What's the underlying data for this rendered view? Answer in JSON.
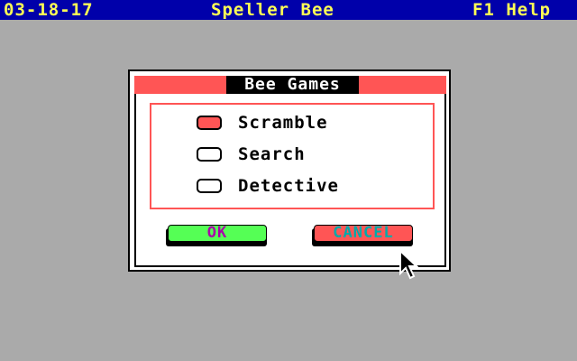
{
  "topbar": {
    "date": "03-18-17",
    "app_title": "Speller Bee",
    "help": "F1 Help"
  },
  "dialog": {
    "title": "Bee Games",
    "options": [
      {
        "label": "Scramble",
        "selected": true
      },
      {
        "label": "Search",
        "selected": false
      },
      {
        "label": "Detective",
        "selected": false
      }
    ],
    "ok_label": "OK",
    "cancel_label": "CANCEL"
  },
  "colors": {
    "background": "#aaaaaa",
    "topbar_bg": "#0000aa",
    "topbar_text": "#ffff55",
    "accent_red": "#ff5555",
    "ok_green": "#55ff55",
    "ok_text": "#aa00aa",
    "cancel_text": "#00aaaa"
  },
  "icons": {
    "cursor": "mouse-pointer-arrow"
  }
}
